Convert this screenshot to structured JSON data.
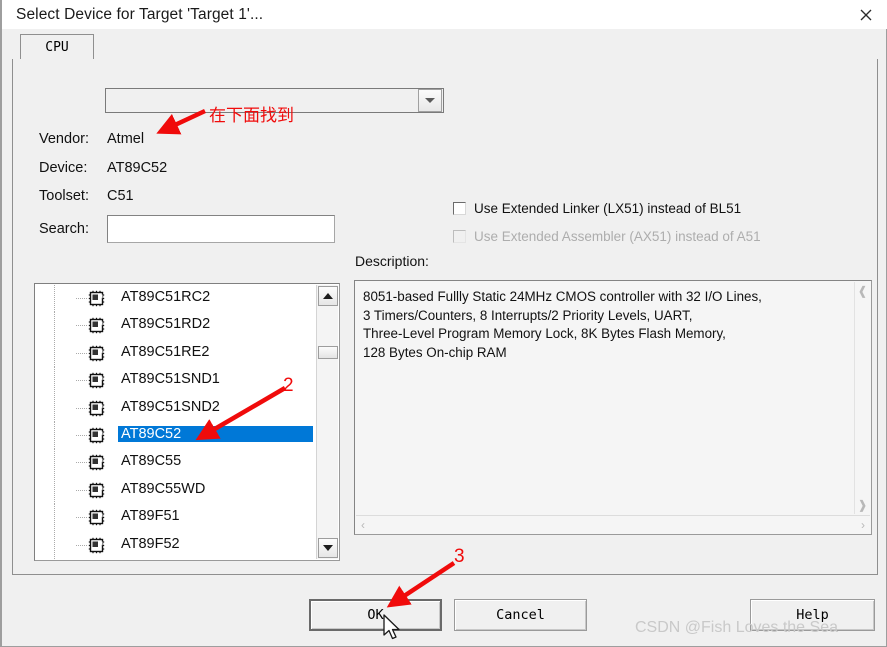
{
  "window": {
    "title": "Select Device for Target 'Target 1'...",
    "close_label": "×"
  },
  "tabs": [
    {
      "label": "CPU",
      "active": true
    }
  ],
  "form": {
    "vendor_combo": {
      "value": "",
      "placeholder": ""
    },
    "vendor": {
      "label": "Vendor:",
      "value": "Atmel"
    },
    "device": {
      "label": "Device:",
      "value": "AT89C52"
    },
    "toolset": {
      "label": "Toolset:",
      "value": "C51"
    },
    "search": {
      "label": "Search:",
      "value": "",
      "placeholder": ""
    }
  },
  "options": [
    {
      "label": "Use Extended Linker (LX51) instead of BL51",
      "checked": false,
      "disabled": false
    },
    {
      "label": "Use Extended Assembler (AX51) instead of A51",
      "checked": false,
      "disabled": true
    }
  ],
  "description": {
    "label": "Description:",
    "text": "8051-based Fullly Static 24MHz CMOS controller with 32  I/O Lines,\n3 Timers/Counters, 8 Interrupts/2 Priority Levels, UART,\nThree-Level Program Memory Lock, 8K Bytes Flash Memory,\n128 Bytes On-chip RAM"
  },
  "device_list": {
    "selected": "AT89C52",
    "items": [
      {
        "label": "AT89C51RC2",
        "selected": false
      },
      {
        "label": "AT89C51RD2",
        "selected": false
      },
      {
        "label": "AT89C51RE2",
        "selected": false
      },
      {
        "label": "AT89C51SND1",
        "selected": false
      },
      {
        "label": "AT89C51SND2",
        "selected": false
      },
      {
        "label": "AT89C52",
        "selected": true
      },
      {
        "label": "AT89C55",
        "selected": false
      },
      {
        "label": "AT89C55WD",
        "selected": false
      },
      {
        "label": "AT89F51",
        "selected": false
      },
      {
        "label": "AT89F52",
        "selected": false
      }
    ]
  },
  "buttons": {
    "ok": "OK",
    "cancel": "Cancel",
    "help": "Help"
  },
  "watermark": "CSDN @Fish Loves the Sea",
  "annotations": [
    {
      "id": "cn",
      "text": "在下面找到"
    },
    {
      "id": "two",
      "text": "2"
    },
    {
      "id": "three",
      "text": "3"
    }
  ],
  "colors": {
    "selection_blue": "#0078d7",
    "annotation_red": "#f00b0b",
    "dialog_bg": "#f0f0f0",
    "titlebar_bg": "#ffffff",
    "watermark_gray": "#c9c9c9"
  }
}
